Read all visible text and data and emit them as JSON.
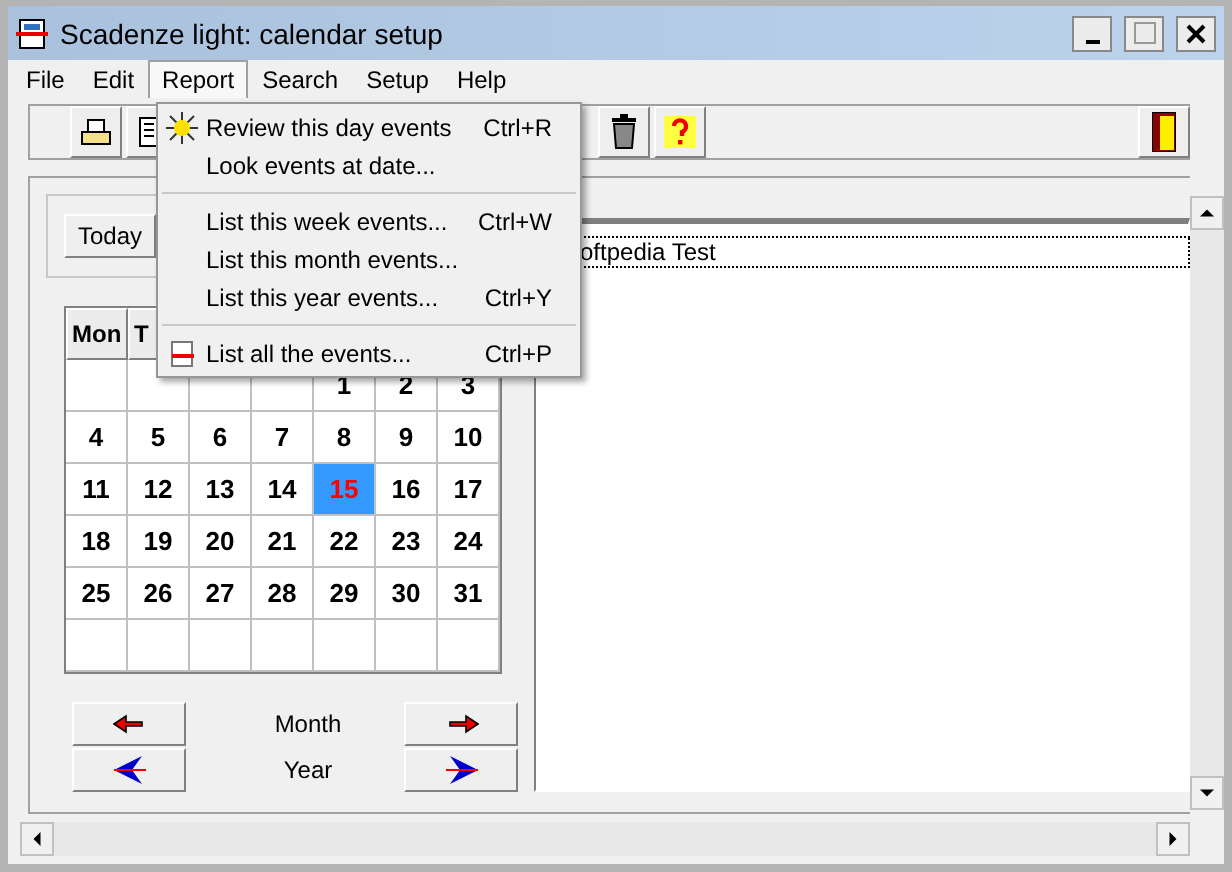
{
  "window": {
    "title": "Scadenze light: calendar setup"
  },
  "menu_bar": [
    {
      "label": "File",
      "selected": false
    },
    {
      "label": "Edit",
      "selected": false
    },
    {
      "label": "Report",
      "selected": true
    },
    {
      "label": "Search",
      "selected": false
    },
    {
      "label": "Setup",
      "selected": false
    },
    {
      "label": "Help",
      "selected": false
    }
  ],
  "report_menu": [
    {
      "kind": "sun",
      "label": "Review this day events",
      "shortcut": "Ctrl+R"
    },
    {
      "kind": "plain",
      "label": "Look events at date..."
    },
    {
      "kind": "separator"
    },
    {
      "kind": "plain",
      "label": "List this week events...",
      "shortcut": "Ctrl+W"
    },
    {
      "kind": "plain",
      "label": "List this month events..."
    },
    {
      "kind": "plain",
      "label": "List this year events...",
      "shortcut": "Ctrl+Y"
    },
    {
      "kind": "separator"
    },
    {
      "kind": "list",
      "label": "List all the events...",
      "shortcut": "Ctrl+P"
    }
  ],
  "toolbar": [
    {
      "kind": "printer"
    },
    {
      "kind": "document"
    },
    {
      "kind": "gap"
    },
    {
      "kind": "trash"
    },
    {
      "kind": "help"
    },
    {
      "kind": "spacer"
    },
    {
      "kind": "exit"
    }
  ],
  "today_button": "Today",
  "calendar": {
    "headers": [
      "Mon",
      "T"
    ],
    "weeks": [
      [
        {
          "kind": "blank"
        },
        {
          "kind": "blank"
        },
        {
          "kind": "blank"
        },
        {
          "kind": "blank"
        },
        {
          "kind": "day",
          "day": "1",
          "selected": false
        },
        {
          "kind": "day",
          "day": "2",
          "selected": false
        },
        {
          "kind": "day",
          "day": "3",
          "selected": false
        }
      ],
      [
        {
          "kind": "day",
          "day": "4",
          "selected": false
        },
        {
          "kind": "day",
          "day": "5",
          "selected": false
        },
        {
          "kind": "day",
          "day": "6",
          "selected": false
        },
        {
          "kind": "day",
          "day": "7",
          "selected": false
        },
        {
          "kind": "day",
          "day": "8",
          "selected": false
        },
        {
          "kind": "day",
          "day": "9",
          "selected": false
        },
        {
          "kind": "day",
          "day": "10",
          "selected": false
        }
      ],
      [
        {
          "kind": "day",
          "day": "11",
          "selected": false
        },
        {
          "kind": "day",
          "day": "12",
          "selected": false
        },
        {
          "kind": "day",
          "day": "13",
          "selected": false
        },
        {
          "kind": "day",
          "day": "14",
          "selected": false
        },
        {
          "kind": "day",
          "day": "15",
          "selected": true
        },
        {
          "kind": "day",
          "day": "16",
          "selected": false
        },
        {
          "kind": "day",
          "day": "17",
          "selected": false
        }
      ],
      [
        {
          "kind": "day",
          "day": "18",
          "selected": false
        },
        {
          "kind": "day",
          "day": "19",
          "selected": false
        },
        {
          "kind": "day",
          "day": "20",
          "selected": false
        },
        {
          "kind": "day",
          "day": "21",
          "selected": false
        },
        {
          "kind": "day",
          "day": "22",
          "selected": false
        },
        {
          "kind": "day",
          "day": "23",
          "selected": false
        },
        {
          "kind": "day",
          "day": "24",
          "selected": false
        }
      ],
      [
        {
          "kind": "day",
          "day": "25",
          "selected": false
        },
        {
          "kind": "day",
          "day": "26",
          "selected": false
        },
        {
          "kind": "day",
          "day": "27",
          "selected": false
        },
        {
          "kind": "day",
          "day": "28",
          "selected": false
        },
        {
          "kind": "day",
          "day": "29",
          "selected": false
        },
        {
          "kind": "day",
          "day": "30",
          "selected": false
        },
        {
          "kind": "day",
          "day": "31",
          "selected": false
        }
      ],
      [
        {
          "kind": "blank"
        },
        {
          "kind": "blank"
        },
        {
          "kind": "blank"
        },
        {
          "kind": "blank"
        },
        {
          "kind": "blank"
        },
        {
          "kind": "blank"
        },
        {
          "kind": "blank"
        }
      ]
    ]
  },
  "navigation": [
    {
      "label": "Month",
      "kind": "small"
    },
    {
      "label": "Year",
      "kind": "large"
    }
  ],
  "events": [
    {
      "label": "oftpedia Test",
      "selected": true
    }
  ]
}
